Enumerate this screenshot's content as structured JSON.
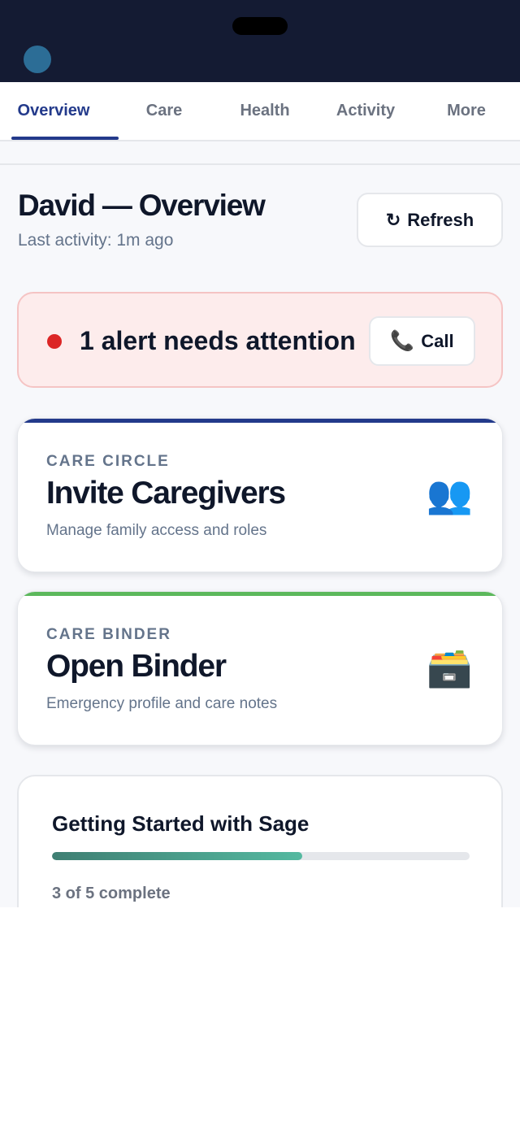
{
  "tabs": [
    {
      "label": "Overview",
      "active": true
    },
    {
      "label": "Care"
    },
    {
      "label": "Health"
    },
    {
      "label": "Activity"
    },
    {
      "label": "More"
    }
  ],
  "header": {
    "title": "David — Overview",
    "subtitle": "Last activity: 1m ago",
    "refresh_label": "Refresh",
    "refresh_icon": "refresh-icon"
  },
  "alert": {
    "text": "1 alert needs attention",
    "call_label": "Call",
    "call_icon": "phone-icon",
    "dot_color": "#dc2626"
  },
  "cards": [
    {
      "eyebrow": "CARE CIRCLE",
      "title": "Invite Caregivers",
      "description": "Manage family access and roles",
      "icon": "people-icon",
      "accent": "#233a8b"
    },
    {
      "eyebrow": "CARE BINDER",
      "title": "Open Binder",
      "description": "Emergency profile and care notes",
      "icon": "card-file-box-icon",
      "accent": "#5cb85c"
    }
  ],
  "getting_started": {
    "title": "Getting Started with Sage",
    "progress_text": "3 of 5 complete",
    "completed": 3,
    "total": 5,
    "progress_fraction": 0.6
  },
  "colors": {
    "navy": "#141b33",
    "brand_blue": "#233a8b",
    "muted": "#64748b"
  }
}
